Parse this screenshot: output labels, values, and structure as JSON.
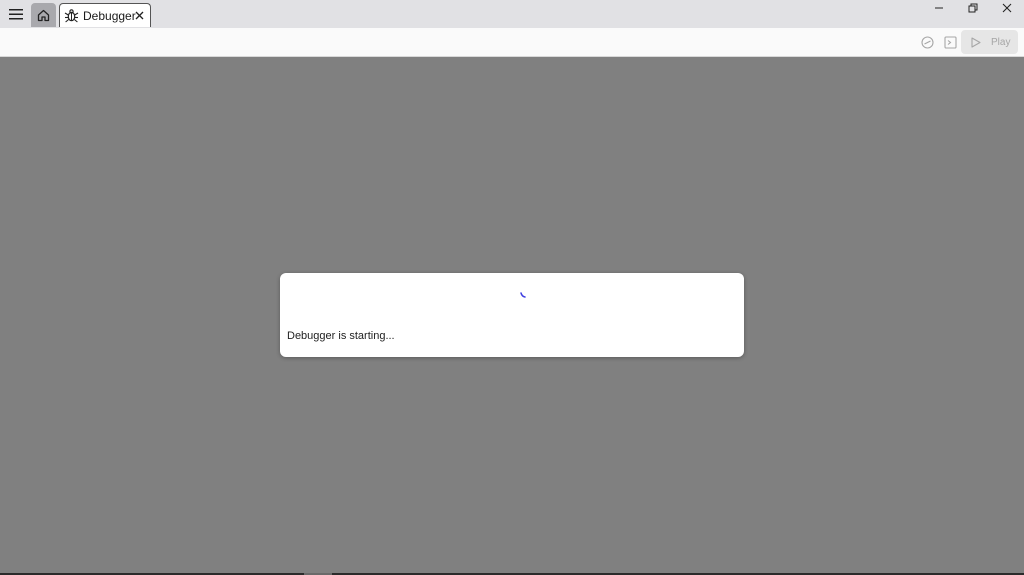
{
  "tabs": {
    "home": {
      "icon": "home-icon"
    },
    "debugger": {
      "label": "Debugger",
      "icon": "bug-icon"
    }
  },
  "toolbar": {
    "play_label": "Play"
  },
  "dialog": {
    "message": "Debugger is starting..."
  },
  "colors": {
    "overlay": "#808080",
    "titlebar": "#e1e1e4",
    "spinner": "#3f3fe0",
    "disabled": "#a6a6a6"
  }
}
